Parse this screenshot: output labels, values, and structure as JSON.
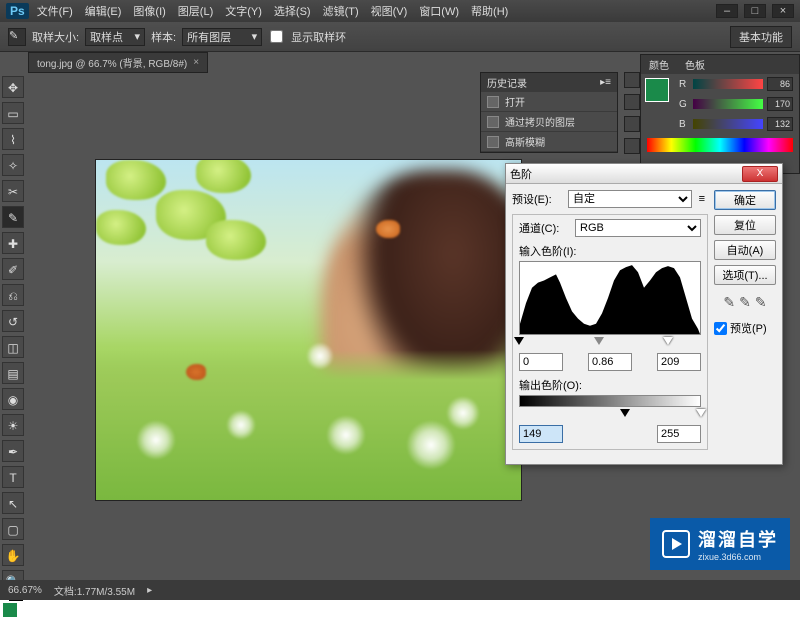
{
  "menu": [
    "文件(F)",
    "编辑(E)",
    "图像(I)",
    "图层(L)",
    "文字(Y)",
    "选择(S)",
    "滤镜(T)",
    "视图(V)",
    "窗口(W)",
    "帮助(H)"
  ],
  "ps_label": "Ps",
  "optbar": {
    "sample_size_label": "取样大小:",
    "sample_size_value": "取样点",
    "sample_label": "样本:",
    "sample_value": "所有图层",
    "show_ring": "显示取样环",
    "basic_fn": "基本功能"
  },
  "tab": {
    "title": "tong.jpg @ 66.7% (背景, RGB/8#)"
  },
  "history": {
    "title": "历史记录",
    "items": [
      "打开",
      "通过拷贝的图层",
      "高斯模糊"
    ]
  },
  "color_panel": {
    "tab1": "颜色",
    "tab2": "色板",
    "r": 86,
    "g": 170,
    "b": 132
  },
  "dialog": {
    "title": "色阶",
    "preset_label": "预设(E):",
    "preset_value": "自定",
    "channel_label": "通道(C):",
    "channel_value": "RGB",
    "input_label": "输入色阶(I):",
    "output_label": "输出色阶(O):",
    "in_black": "0",
    "in_gamma": "0.86",
    "in_white": "209",
    "out_black": "149",
    "out_white": "255",
    "ok": "确定",
    "cancel": "复位",
    "auto": "自动(A)",
    "options": "选项(T)...",
    "preview": "预览(P)"
  },
  "status": {
    "zoom": "66.67%",
    "doc": "文档:1.77M/3.55M"
  },
  "watermark": {
    "big": "溜溜自学",
    "small": "zixue.3d66.com"
  }
}
